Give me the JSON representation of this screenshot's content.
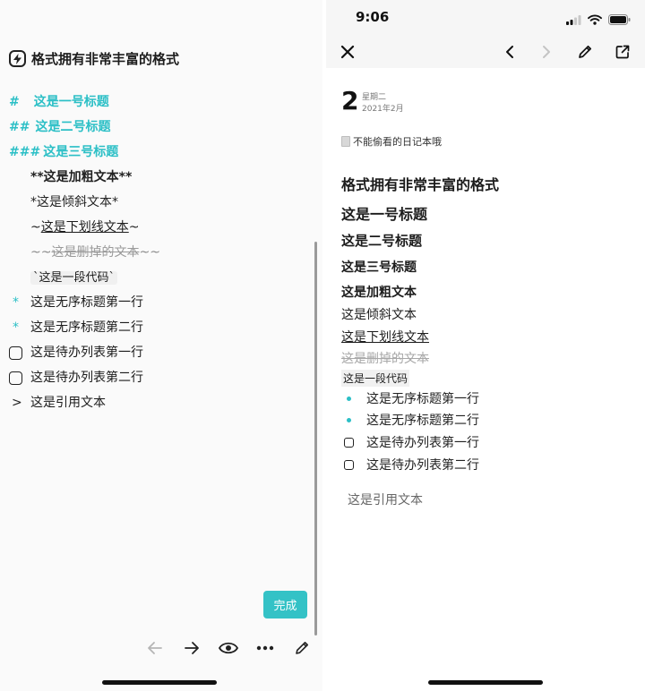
{
  "editor": {
    "title": "格式拥有非常丰富的格式",
    "h1_mark": "#",
    "h1_text": "这是一号标题",
    "h2_mark": "##",
    "h2_text": "这是二号标题",
    "h3_mark": "###",
    "h3_text": "这是三号标题",
    "bold_line": "**这是加粗文本**",
    "italic_line": "*这是倾斜文本*",
    "underline_pre": "~",
    "underline_text": "这是下划线文本",
    "underline_post": "~",
    "strike_pre": "~~",
    "strike_text": "这是删掉的文本",
    "strike_post": "~~",
    "code_line": "`这是一段代码`",
    "bullet_mark": "*",
    "bullet_1": "这是无序标题第一行",
    "bullet_2": "这是无序标题第二行",
    "todo_1": "这是待办列表第一行",
    "todo_2": "这是待办列表第二行",
    "quote_mark": ">",
    "quote_text": "这是引用文本",
    "done_label": "完成",
    "toolbar_icons": [
      "arrow-left-icon",
      "arrow-right-icon",
      "eye-icon",
      "more-icon",
      "pencil-icon"
    ]
  },
  "preview": {
    "status_time": "9:06",
    "date_day": "2",
    "date_weekday": "星期二",
    "date_year_month": "2021年2月",
    "diary_name": "不能偷看的日记本哦",
    "title": "格式拥有非常丰富的格式",
    "h1": "这是一号标题",
    "h2": "这是二号标题",
    "h3": "这是三号标题",
    "bold": "这是加粗文本",
    "italic": "这是倾斜文本",
    "underline": "这是下划线文本",
    "strike": "这是删掉的文本",
    "code": "这是一段代码",
    "bullets": [
      "这是无序标题第一行",
      "这是无序标题第二行"
    ],
    "todos": [
      "这是待办列表第一行",
      "这是待办列表第二行"
    ],
    "quote": "这是引用文本"
  },
  "colors": {
    "accent": "#2bbfc6",
    "done_button": "#34c2c6"
  }
}
